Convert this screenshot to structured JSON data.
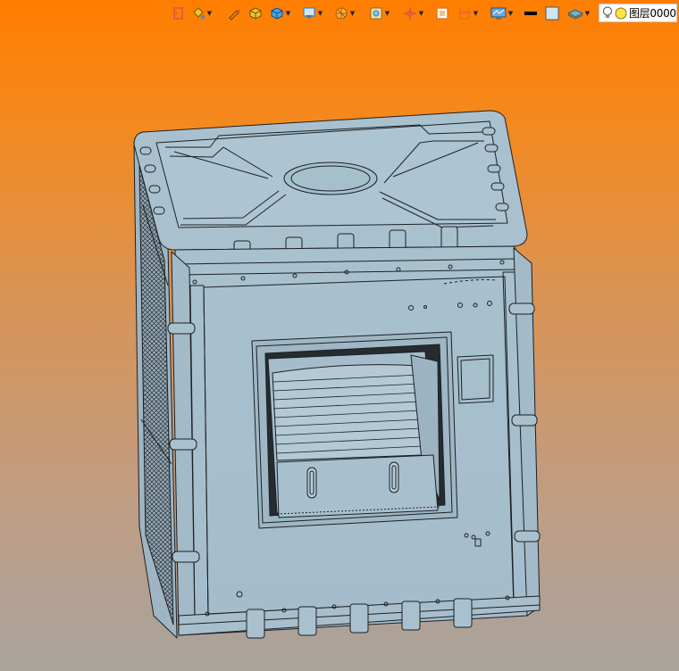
{
  "toolbar": {
    "icons": [
      {
        "name": "exit-icon",
        "has_dropdown": false
      },
      {
        "name": "paint-bucket-icon",
        "has_dropdown": true
      },
      {
        "name": "pencil-icon",
        "has_dropdown": false
      },
      {
        "name": "shaded-solid-icon",
        "has_dropdown": false
      },
      {
        "name": "render-style-icon",
        "has_dropdown": true
      },
      {
        "name": "view-cube-icon",
        "has_dropdown": true
      },
      {
        "name": "filter-icon",
        "has_dropdown": true
      },
      {
        "name": "snap-select-icon",
        "has_dropdown": true
      },
      {
        "name": "origin-icon",
        "has_dropdown": true
      },
      {
        "name": "frame-icon",
        "has_dropdown": false
      },
      {
        "name": "section-icon",
        "has_dropdown": true
      },
      {
        "name": "monitor-icon",
        "has_dropdown": true
      },
      {
        "name": "line-color-swatch-icon",
        "has_dropdown": false
      },
      {
        "name": "fill-color-swatch-icon",
        "has_dropdown": false
      },
      {
        "name": "layers-icon",
        "has_dropdown": true
      }
    ],
    "layer_label": "图层0000",
    "colors": {
      "line_swatch": "#000000",
      "fill_swatch": "#cfe6f5",
      "accent_orange": "#e8731a",
      "accent_blue": "#1f7fd1"
    }
  },
  "viewport": {
    "background_top": "#ff7e00",
    "background_bottom": "#a9a39d",
    "model_color": "#a9c0ce",
    "model_edge_color": "#1a1d20"
  }
}
